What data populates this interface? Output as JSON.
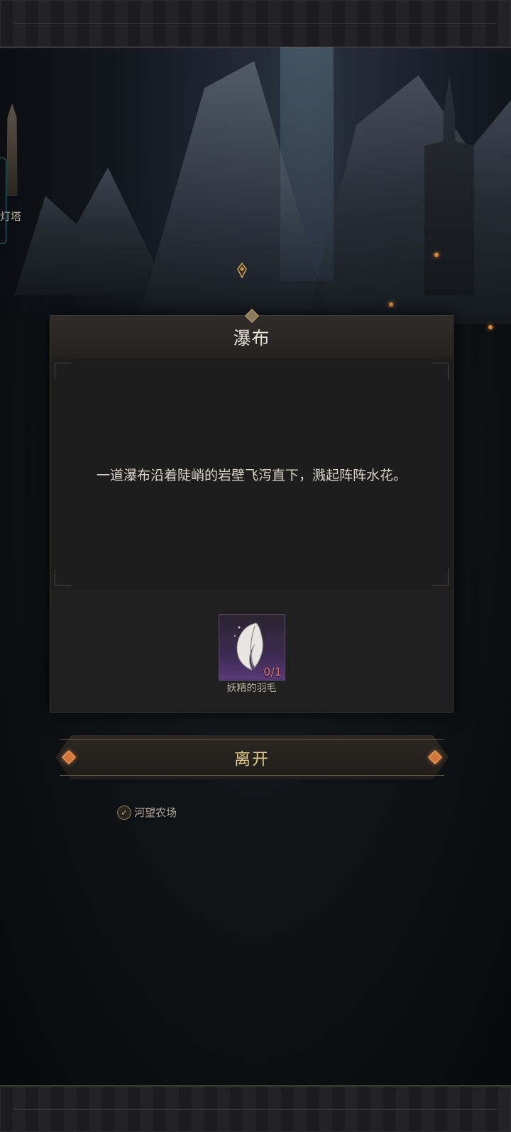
{
  "map": {
    "lighthouse_label": "灯塔",
    "farm_label": "河望农场"
  },
  "dialog": {
    "title": "瀑布",
    "description": "一道瀑布沿着陡峭的岩壁飞泻直下，溅起阵阵水花。",
    "item": {
      "icon": "feather-icon",
      "count": "0/1",
      "name": "妖精的羽毛",
      "count_color": "#e07070"
    }
  },
  "actions": {
    "leave_label": "离开"
  },
  "colors": {
    "accent_gold": "#e2c88c",
    "gem_orange": "#d4763a"
  }
}
